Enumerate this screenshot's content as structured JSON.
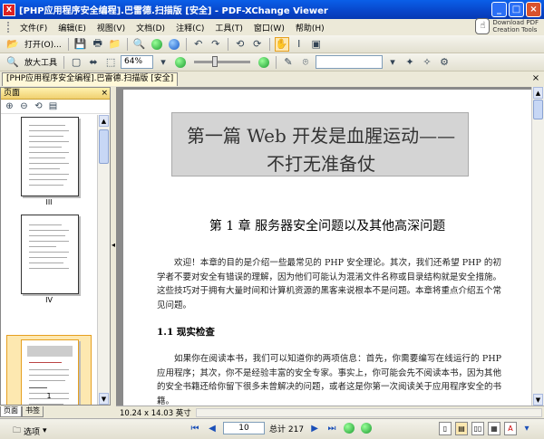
{
  "window": {
    "title": "[PHP应用程序安全编程].巴雷德.扫描版 [安全] - PDF-XChange Viewer",
    "minimize": "_",
    "maximize": "□",
    "close": "×"
  },
  "menu": [
    "文件(F)",
    "编辑(E)",
    "视图(V)",
    "文档(D)",
    "注释(C)",
    "工具(T)",
    "窗口(W)",
    "帮助(H)"
  ],
  "download_pdf": {
    "line1": "Download PDF",
    "line2": "Creation Tools"
  },
  "toolbar1": {
    "open_label": "打开(O)..."
  },
  "toolbar2": {
    "zoom_tool_label": "放大工具",
    "zoom_value": "64%"
  },
  "document_tab": {
    "label": "[PHP应用程序安全编程].巴雷德.扫描版 [安全]"
  },
  "left_panel": {
    "header": "页面",
    "thumbnails": [
      {
        "label": "III"
      },
      {
        "label": "IV"
      },
      {
        "label": "1"
      }
    ],
    "tabs": [
      "页面",
      "书签"
    ]
  },
  "page": {
    "part_line1": "第一篇   Web 开发是血腥运动——",
    "part_line2": "不打无准备仗",
    "chapter_title": "第 1 章   服务器安全问题以及其他高深问题",
    "para1": "欢迎！本章的目的是介绍一些最常见的 PHP 安全理论。其次，我们还希望 PHP 的初学者不要对安全有错误的理解，因为他们可能认为混淆文件名称或目录结构就是安全措施。这些技巧对于拥有大量时间和计算机资源的黑客来说根本不是问题。本章将重点介绍五个常见问题。",
    "section_heading": "1.1   现实检查",
    "para2": "如果你在阅读本书，我们可以知道你的两项信息：首先，你需要编写在线运行的 PHP 应用程序；其次，你不是经验丰富的安全专家。事实上，你可能会先不阅读本书，因为其他的安全书籍还给你留下很多未曾解决的问题，或者这是你第一次阅读关于应用程序安全的书籍。"
  },
  "doc_status": {
    "size": "10.24 x 14.03 英寸"
  },
  "statusbar": {
    "options_label": "选项",
    "page_value": "10",
    "page_total": "总计 217"
  }
}
